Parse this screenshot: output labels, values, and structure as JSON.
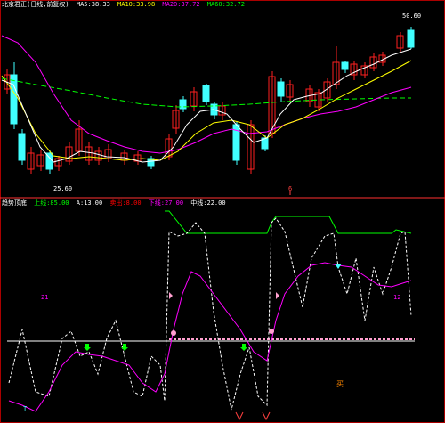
{
  "top_panel": {
    "title": "北京君正(日线,前复权)",
    "ma_labels": [
      {
        "text": "MA5:38.33",
        "color": "#ffffff"
      },
      {
        "text": "MA10:33.98",
        "color": "#ffff00"
      },
      {
        "text": "MA20:37.72",
        "color": "#ff00ff"
      },
      {
        "text": "MA60:32.72",
        "color": "#00ff00"
      }
    ],
    "price_high_label": "50.60",
    "price_low_label": "25.60",
    "bottom_marker": "6"
  },
  "bottom_panel": {
    "title": "趋势顶底",
    "indicators": [
      {
        "text": "上线:85.00",
        "color": "#00ff00"
      },
      {
        "text": "A:13.00",
        "color": "#ffffff"
      },
      {
        "text": "卖出:8.00",
        "color": "#ff0000"
      },
      {
        "text": "下线:27.00",
        "color": "#ff00ff"
      },
      {
        "text": "中线:22.00",
        "color": "#ffffff"
      }
    ],
    "markers": [
      {
        "text": "21",
        "color": "#ff00ff"
      },
      {
        "text": "12",
        "color": "#ff00ff"
      },
      {
        "text": "买",
        "color": "#ff8800"
      },
      {
        "text": "T",
        "color": "#00ffff"
      }
    ]
  },
  "colors": {
    "up": "#ff2020",
    "down": "#40ffff",
    "ma5": "#ffffff",
    "ma10": "#ffff00",
    "ma20": "#ff00ff",
    "ma60": "#00ff00",
    "divider": "#ff3030",
    "midline": "#ff9fcf"
  }
}
